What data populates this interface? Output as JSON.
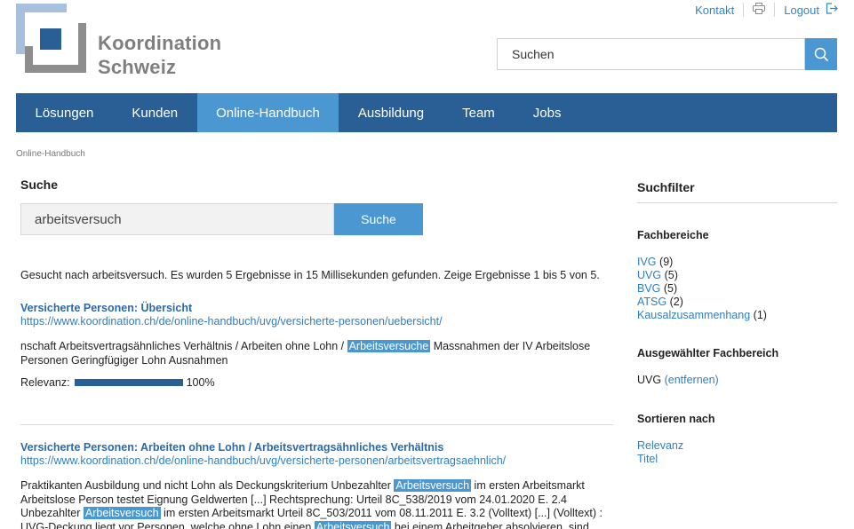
{
  "header": {
    "logo_line1": "Koordination",
    "logo_line2": "Schweiz",
    "links": {
      "contact": "Kontakt",
      "logout": "Logout"
    },
    "search_placeholder": "Suchen"
  },
  "nav": {
    "items": [
      "Lösungen",
      "Kunden",
      "Online-Handbuch",
      "Ausbildung",
      "Team",
      "Jobs"
    ],
    "active_index": 2
  },
  "breadcrumb": "Online-Handbuch",
  "search": {
    "title": "Suche",
    "query": "arbeitsversuch",
    "button": "Suche",
    "summary": "Gesucht nach arbeitsversuch. Es wurden 5 Ergebnisse in 15 Millisekunden gefunden. Zeige Ergebnisse 1 bis 5 von 5."
  },
  "results": [
    {
      "title": "Versicherte Personen: Übersicht",
      "url": "https://www.koordination.ch/de/online-handbuch/uvg/versicherte-personen/uebersicht/",
      "snippet_before": "nschaft Arbeitsvertragsähnliches Verhältnis / Arbeiten ohne Lohn / ",
      "snippet_hl": "Arbeitsversuche",
      "snippet_after": " Massnahmen der IV Arbeitslose Personen Geringfügiger Lohn Ausnahmen",
      "relevance_label": "Relevanz:",
      "relevance": "100%"
    },
    {
      "title": "Versicherte Personen: Arbeiten ohne Lohn / Arbeitsvertragsähnliches Verhältnis",
      "url": "https://www.koordination.ch/de/online-handbuch/uvg/versicherte-personen/arbeitsvertragsaehnlich/",
      "snippet_1": "Praktikanten Ausbildung und nicht Lohn als Deckungskriterium Unbezahlter ",
      "hl_1": "Arbeitsversuch",
      "snippet_2": " im ersten Arbeitsmarkt Arbeitslose Person testet Eignung Geldwerten [...] Rechtsprechung: Urteil 8C_538/2019 vom 24.01.2020 E. 2.4 Unbezahlter ",
      "hl_2": "Arbeitsversuch",
      "snippet_3": " im ersten Arbeitsmarkt Urteil 8C_503/2011 vom 08.11.2011 E. 3.2 (Volltext) [...] (Volltext) : UVG-Deckung liegt vor Personen, welche ohne Lohn einen ",
      "hl_3": "Arbeitsversuch",
      "snippet_4": " bei einem Arbeitgeber absolvieren, sind dann über diesen"
    }
  ],
  "filters": {
    "title": "Suchfilter",
    "fachbereiche_title": "Fachbereiche",
    "fachbereiche": [
      {
        "name": "IVG",
        "count": "(9)"
      },
      {
        "name": "UVG",
        "count": "(5)"
      },
      {
        "name": "BVG",
        "count": "(5)"
      },
      {
        "name": "ATSG",
        "count": "(2)"
      },
      {
        "name": "Kausalzusammenhang",
        "count": "(1)"
      }
    ],
    "selected_title": "Ausgewählter Fachbereich",
    "selected_value": "UVG",
    "selected_remove": "(entfernen)",
    "sort_title": "Sortieren nach",
    "sort_options": [
      "Relevanz",
      "Titel"
    ]
  },
  "colors": {
    "nav_bg": "#2a5f95",
    "nav_active": "#4a97d2",
    "link": "#2f7fc0",
    "highlight": "#4a97d2"
  }
}
